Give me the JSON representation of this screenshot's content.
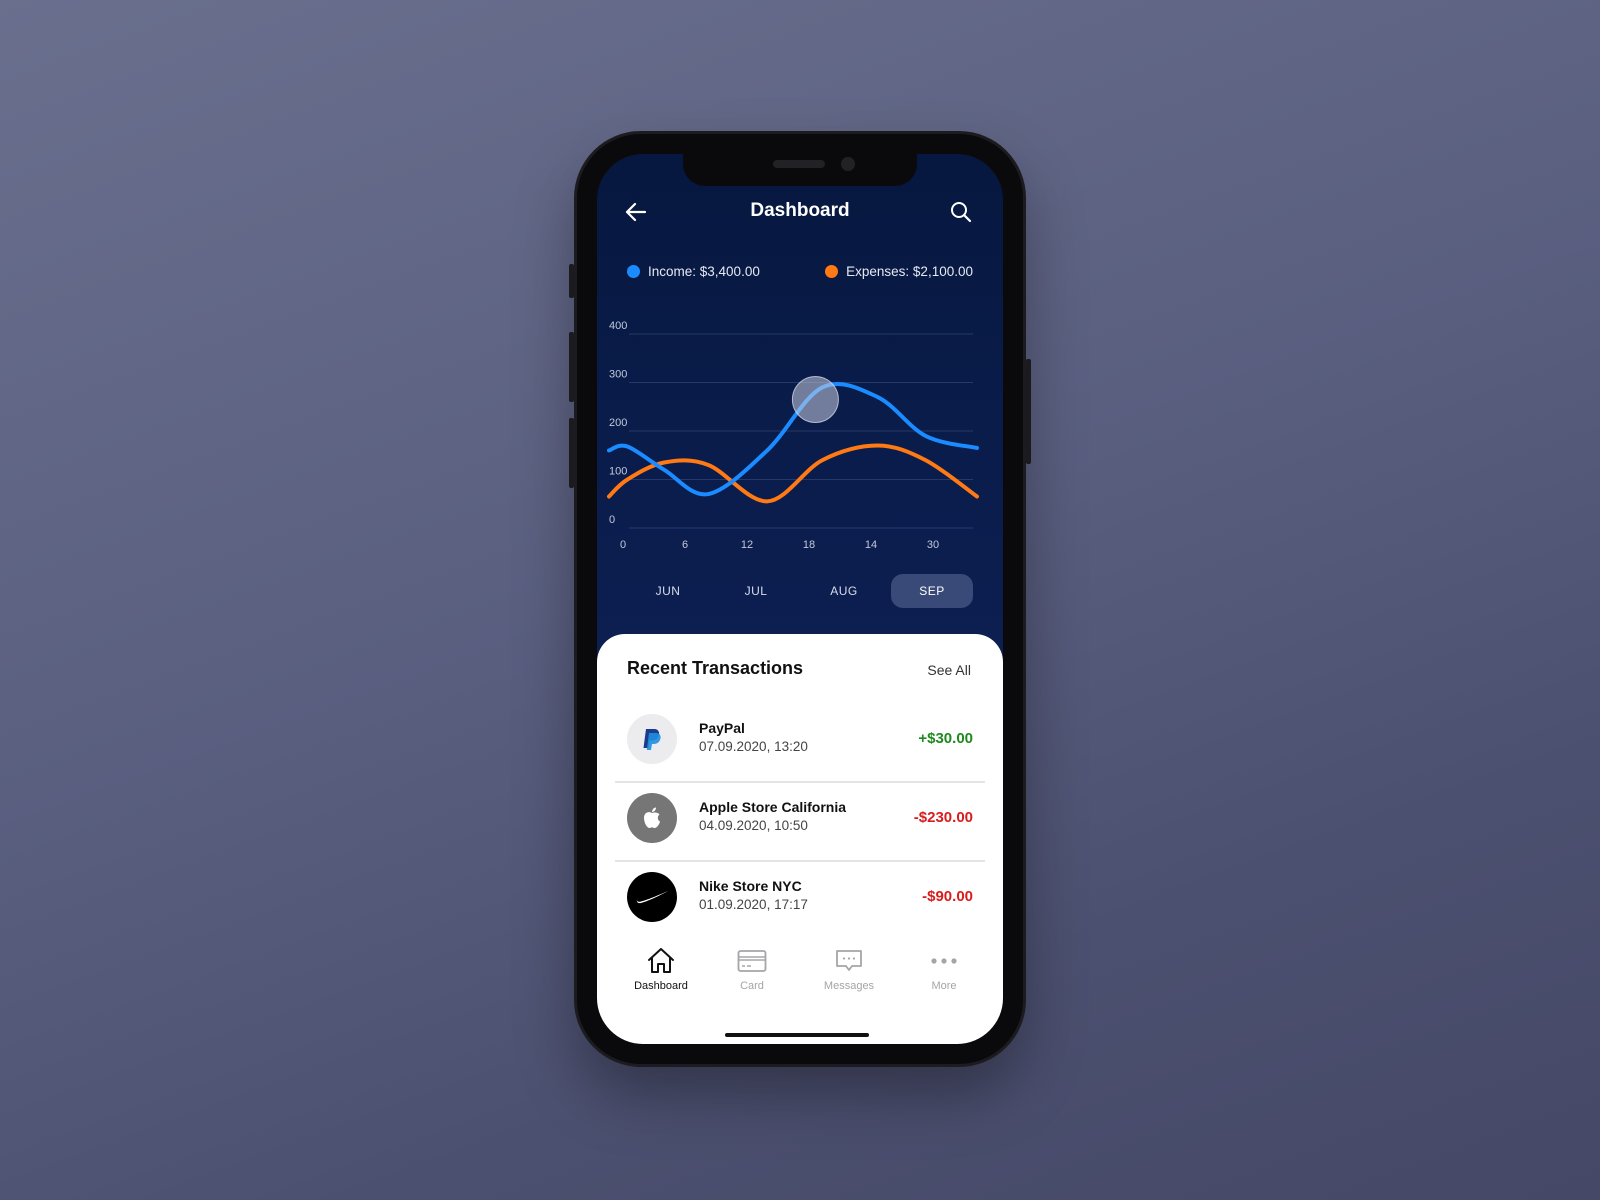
{
  "header": {
    "title": "Dashboard",
    "back_icon": "arrow-left-icon",
    "search_icon": "search-icon"
  },
  "legend": {
    "income": {
      "label": "Income: $3,400.00",
      "color": "#1a8cff"
    },
    "expenses": {
      "label": "Expenses: $2,100.00",
      "color": "#ff7a14"
    }
  },
  "chart_data": {
    "type": "line",
    "title": "",
    "xlabel": "",
    "ylabel": "",
    "x_tick_labels": [
      "0",
      "6",
      "12",
      "18",
      "14",
      "30"
    ],
    "y_tick_labels": [
      "0",
      "100",
      "200",
      "300",
      "400"
    ],
    "ylim": [
      0,
      400
    ],
    "grid": true,
    "x_positions": [
      0,
      0.05,
      0.15,
      0.27,
      0.43,
      0.58,
      0.73,
      0.86,
      1.0
    ],
    "series": [
      {
        "name": "Income",
        "color": "#1a8cff",
        "values": [
          160,
          168,
          120,
          70,
          160,
          290,
          270,
          190,
          165
        ]
      },
      {
        "name": "Expenses",
        "color": "#ff7a14",
        "values": [
          65,
          100,
          135,
          130,
          55,
          140,
          170,
          140,
          65
        ]
      }
    ],
    "highlight": {
      "series": "Income",
      "x_position": 0.55,
      "value": 265
    }
  },
  "months": [
    {
      "label": "JUN",
      "active": false
    },
    {
      "label": "JUL",
      "active": false
    },
    {
      "label": "AUG",
      "active": false
    },
    {
      "label": "SEP",
      "active": true
    }
  ],
  "transactions_section": {
    "title": "Recent Transactions",
    "see_all": "See All",
    "items": [
      {
        "name": "PayPal",
        "date": "07.09.2020, 13:20",
        "amount": "+$30.00",
        "amount_color": "#1e8a1e",
        "icon": "paypal-icon"
      },
      {
        "name": "Apple Store California",
        "date": "04.09.2020, 10:50",
        "amount": "-$230.00",
        "amount_color": "#d91c1c",
        "icon": "apple-icon"
      },
      {
        "name": "Nike Store NYC",
        "date": "01.09.2020, 17:17",
        "amount": "-$90.00",
        "amount_color": "#d91c1c",
        "icon": "nike-icon"
      }
    ]
  },
  "tabbar": [
    {
      "label": "Dashboard",
      "icon": "home-icon",
      "active": true
    },
    {
      "label": "Card",
      "icon": "card-icon",
      "active": false
    },
    {
      "label": "Messages",
      "icon": "messages-icon",
      "active": false
    },
    {
      "label": "More",
      "icon": "more-icon",
      "active": false
    }
  ]
}
